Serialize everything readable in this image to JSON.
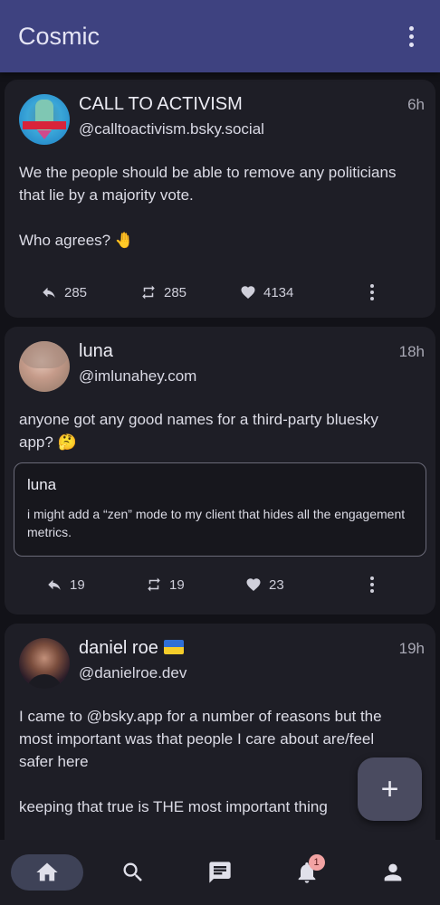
{
  "app": {
    "title": "Cosmic"
  },
  "posts": [
    {
      "name": "CALL TO ACTIVISM",
      "handle": "@calltoactivism.bsky.social",
      "time": "6h",
      "body_lines": [
        "We the people should be able to remove any politicians that lie by a majority vote.",
        "Who agrees? 🤚"
      ],
      "replies": "285",
      "reposts": "285",
      "likes": "4134"
    },
    {
      "name": "luna",
      "handle": "@imlunahey.com",
      "time": "18h",
      "body_lines": [
        "anyone got any good names for a third-party bluesky app? 🤔"
      ],
      "quote": {
        "name": "luna",
        "text": "i might add a “zen” mode to my client that hides all the engagement metrics."
      },
      "replies": "19",
      "reposts": "19",
      "likes": "23"
    },
    {
      "name": "daniel roe",
      "handle": "@danielroe.dev",
      "time": "19h",
      "body_lines": [
        "I came to @bsky.app for a number of reasons but the most important was that people I care about are/feel safer here",
        "keeping that true is THE most important thing"
      ]
    }
  ],
  "nav": {
    "items": [
      "home-icon",
      "search-icon",
      "chat-icon",
      "bell-icon",
      "person-icon"
    ],
    "notification_count": "1"
  },
  "colors": {
    "appbar": "#3e4280",
    "background": "#121218",
    "card": "#1e1e26"
  }
}
